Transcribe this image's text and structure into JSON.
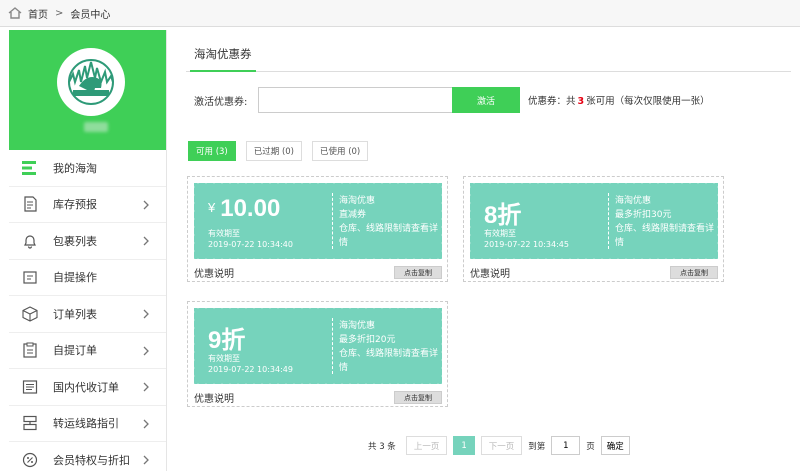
{
  "breadcrumb": {
    "home": "首页",
    "separator": ">",
    "current": "会员中心"
  },
  "sidebar": {
    "items": [
      {
        "label": "我的海淘",
        "icon": "menu-lines-icon",
        "active": true
      },
      {
        "label": "库存预报",
        "icon": "document-icon"
      },
      {
        "label": "包裹列表",
        "icon": "bell-icon"
      },
      {
        "label": "自提操作",
        "icon": "box-icon"
      },
      {
        "label": "订单列表",
        "icon": "cube-icon"
      },
      {
        "label": "自提订单",
        "icon": "clipboard-icon"
      },
      {
        "label": "国内代收订单",
        "icon": "list-icon"
      },
      {
        "label": "转运线路指引",
        "icon": "route-icon"
      },
      {
        "label": "会员特权与折扣",
        "icon": "discount-icon"
      }
    ]
  },
  "main": {
    "tab_title": "海淘优惠券",
    "activate": {
      "label": "激活优惠券:",
      "input_value": "",
      "button": "激活",
      "summary_prefix": "优惠券：共",
      "summary_count": "3",
      "summary_suffix": "张可用（每次仅限使用一张）"
    },
    "filters": [
      {
        "label": "可用 (3)",
        "active": true
      },
      {
        "label": "已过期 (0)"
      },
      {
        "label": "已使用 (0)"
      }
    ],
    "coupons": [
      {
        "currency": "¥",
        "value": "10.00",
        "validity_label": "有效期至",
        "validity_date": "2019-07-22 10:34:40",
        "title": "海淘优惠",
        "subtitle": "直减券",
        "note": "仓库、线路限制请查看详情",
        "footer": "优惠说明",
        "copy_button": "点击复制"
      },
      {
        "currency": "",
        "value": "8折",
        "validity_label": "有效期至",
        "validity_date": "2019-07-22 10:34:45",
        "title": "海淘优惠",
        "subtitle": "最多折扣30元",
        "note": "仓库、线路限制请查看详情",
        "footer": "优惠说明",
        "copy_button": "点击复制"
      },
      {
        "currency": "",
        "value": "9折",
        "validity_label": "有效期至",
        "validity_date": "2019-07-22 10:34:49",
        "title": "海淘优惠",
        "subtitle": "最多折扣20元",
        "note": "仓库、线路限制请查看详情",
        "footer": "优惠说明",
        "copy_button": "点击复制"
      }
    ],
    "pagination": {
      "total": "共 3 条",
      "prev": "上一页",
      "current": "1",
      "next": "下一页",
      "goto_label": "到第",
      "goto_value": "1",
      "page_label": "页",
      "confirm": "确定"
    }
  },
  "colors": {
    "brand_green": "#3fcf57",
    "coupon_teal": "#76d3bc",
    "highlight_red": "#e60012"
  }
}
